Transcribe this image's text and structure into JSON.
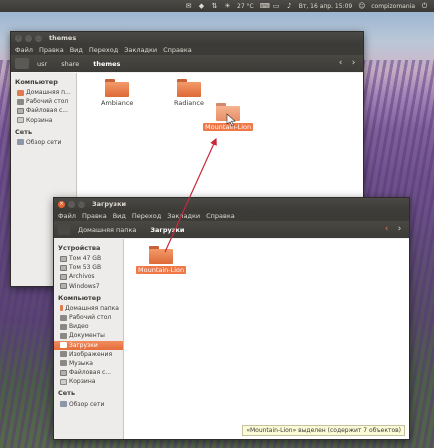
{
  "topbar": {
    "temperature": "27 °C",
    "datetime": "Вт, 16 апр. 15:09",
    "user": "compizomania"
  },
  "window_back": {
    "title": "themes",
    "menu": [
      "Файл",
      "Правка",
      "Вид",
      "Переход",
      "Закладки",
      "Справка"
    ],
    "breadcrumbs": [
      "usr",
      "share",
      "themes"
    ],
    "sidebar": {
      "computer_header": "Компьютер",
      "computer_items": [
        "Домашняя п...",
        "Рабочий стол",
        "Файловая с...",
        "Корзина"
      ],
      "network_header": "Сеть",
      "network_items": [
        "Обзор сети"
      ]
    },
    "folders": [
      "Ambiance",
      "Radiance",
      "Mountain-Lion"
    ]
  },
  "window_front": {
    "title": "Загрузки",
    "menu": [
      "Файл",
      "Правка",
      "Вид",
      "Переход",
      "Закладки",
      "Справка"
    ],
    "breadcrumbs": [
      "Домашняя папка",
      "Загрузки"
    ],
    "sidebar": {
      "devices_header": "Устройства",
      "devices_items": [
        "Том 47 GB",
        "Том 53 GB",
        "Archivos",
        "Windows7"
      ],
      "computer_header": "Компьютер",
      "computer_items": [
        "Домашняя папка",
        "Рабочий стол",
        "Видео",
        "Документы",
        "Загрузки",
        "Изображения",
        "Музыка",
        "Файловая с...",
        "Корзина"
      ],
      "network_header": "Сеть",
      "network_items": [
        "Обзор сети"
      ]
    },
    "folders": [
      "Mountain-Lion"
    ],
    "status": "«Mountain-Lion» выделен (содержит 7 объектов)"
  },
  "colors": {
    "accent": "#f07746",
    "arrow": "#c8293a"
  }
}
